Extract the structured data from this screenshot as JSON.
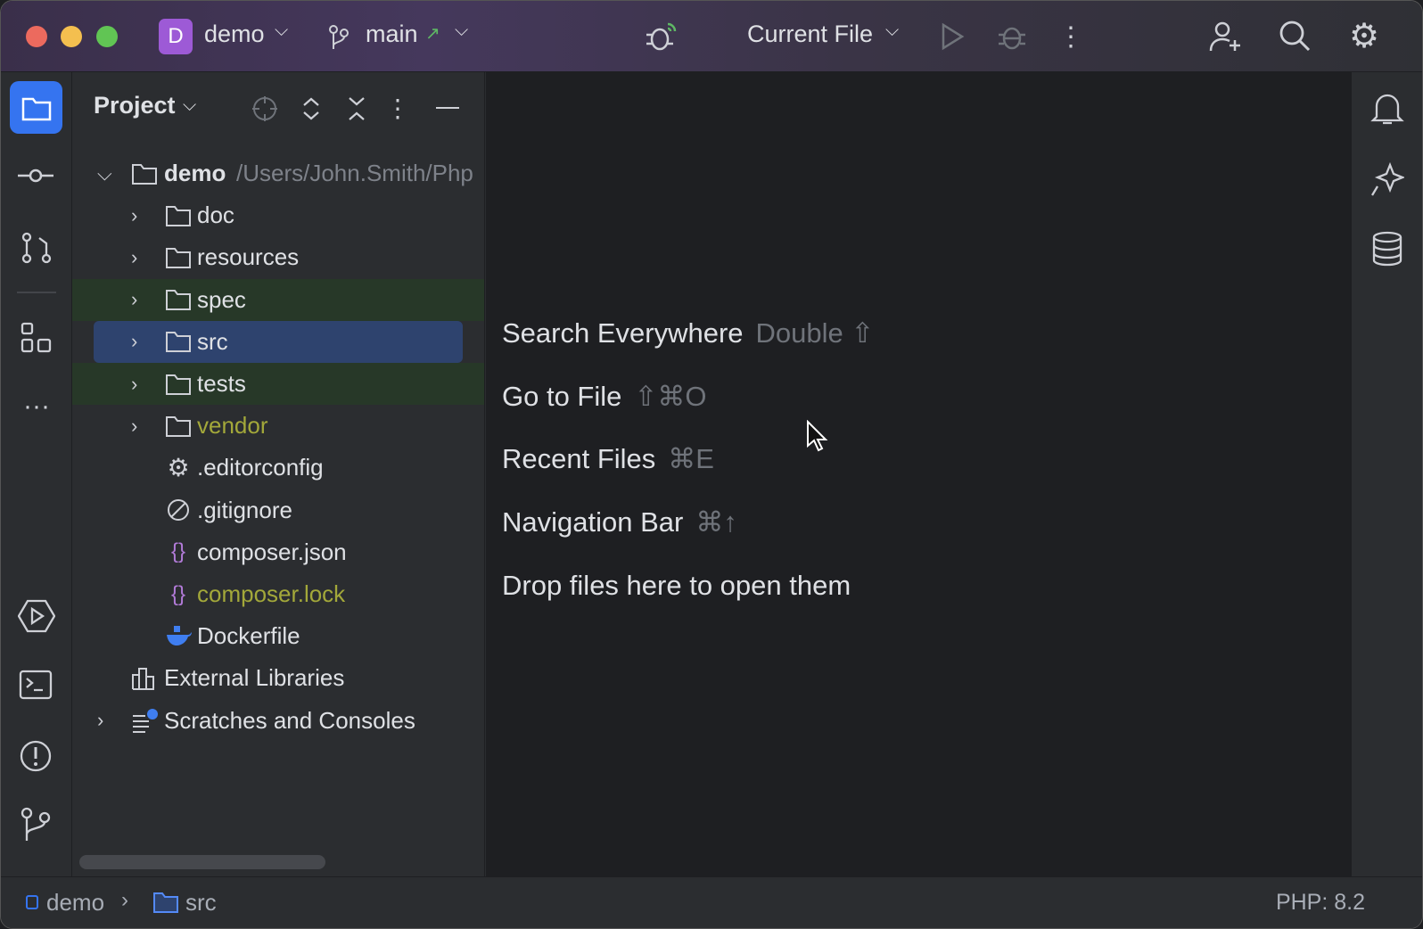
{
  "titlebar": {
    "project_initial": "D",
    "project_name": "demo",
    "branch": "main",
    "run_config": "Current File"
  },
  "project_panel": {
    "title": "Project"
  },
  "tree": [
    {
      "name": "demo",
      "path": "/Users/John.Smith/Php",
      "type": "root",
      "expanded": true
    },
    {
      "name": "doc",
      "type": "folder"
    },
    {
      "name": "resources",
      "type": "folder"
    },
    {
      "name": "spec",
      "type": "folder",
      "highlight": "test"
    },
    {
      "name": "src",
      "type": "folder",
      "selected": true
    },
    {
      "name": "tests",
      "type": "folder",
      "highlight": "test"
    },
    {
      "name": "vendor",
      "type": "folder",
      "color": "#a3a83a"
    },
    {
      "name": ".editorconfig",
      "type": "gear-file"
    },
    {
      "name": ".gitignore",
      "type": "ignore-file"
    },
    {
      "name": "composer.json",
      "type": "json-file"
    },
    {
      "name": "composer.lock",
      "type": "json-file",
      "color": "#a3a83a"
    },
    {
      "name": "Dockerfile",
      "type": "docker-file"
    },
    {
      "name": "External Libraries",
      "type": "libraries"
    },
    {
      "name": "Scratches and Consoles",
      "type": "scratches"
    }
  ],
  "editor_hints": [
    {
      "label": "Search Everywhere",
      "shortcut": "Double ⇧"
    },
    {
      "label": "Go to File",
      "shortcut": "⇧⌘O"
    },
    {
      "label": "Recent Files",
      "shortcut": "⌘E"
    },
    {
      "label": "Navigation Bar",
      "shortcut": "⌘↑"
    },
    {
      "label": "Drop files here to open them",
      "shortcut": ""
    }
  ],
  "statusbar": {
    "crumbs": [
      "demo",
      "src"
    ],
    "php_version": "PHP: 8.2"
  },
  "colors": {
    "accent": "#3574f0",
    "selection": "#2e436e",
    "test_bg": "#273828",
    "vendor": "#a3a83a"
  }
}
